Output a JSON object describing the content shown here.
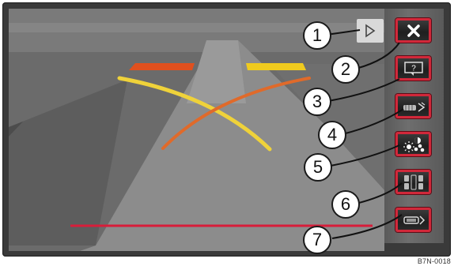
{
  "image_id": "B7N-0018",
  "screen": {
    "guide_line_colors": {
      "near": "#d81d3a",
      "mid": "#e0501e",
      "far": "#f0cb1e",
      "trajectory_orange": "#e06a2a",
      "trajectory_yellow": "#efd23a"
    }
  },
  "menu_toggle": {
    "icon": "play-triangle-icon"
  },
  "buttons": [
    {
      "id": "close",
      "icon": "close-x-icon"
    },
    {
      "id": "help",
      "icon": "help-icon"
    },
    {
      "id": "view-mode",
      "icon": "vehicle-view-icon"
    },
    {
      "id": "display-settings",
      "icon": "brightness-contrast-icon"
    },
    {
      "id": "parallel-parking",
      "icon": "parking-mode-icon"
    },
    {
      "id": "reverse-guidance",
      "icon": "rear-view-icon"
    }
  ],
  "callouts": [
    "1",
    "2",
    "3",
    "4",
    "5",
    "6",
    "7"
  ]
}
